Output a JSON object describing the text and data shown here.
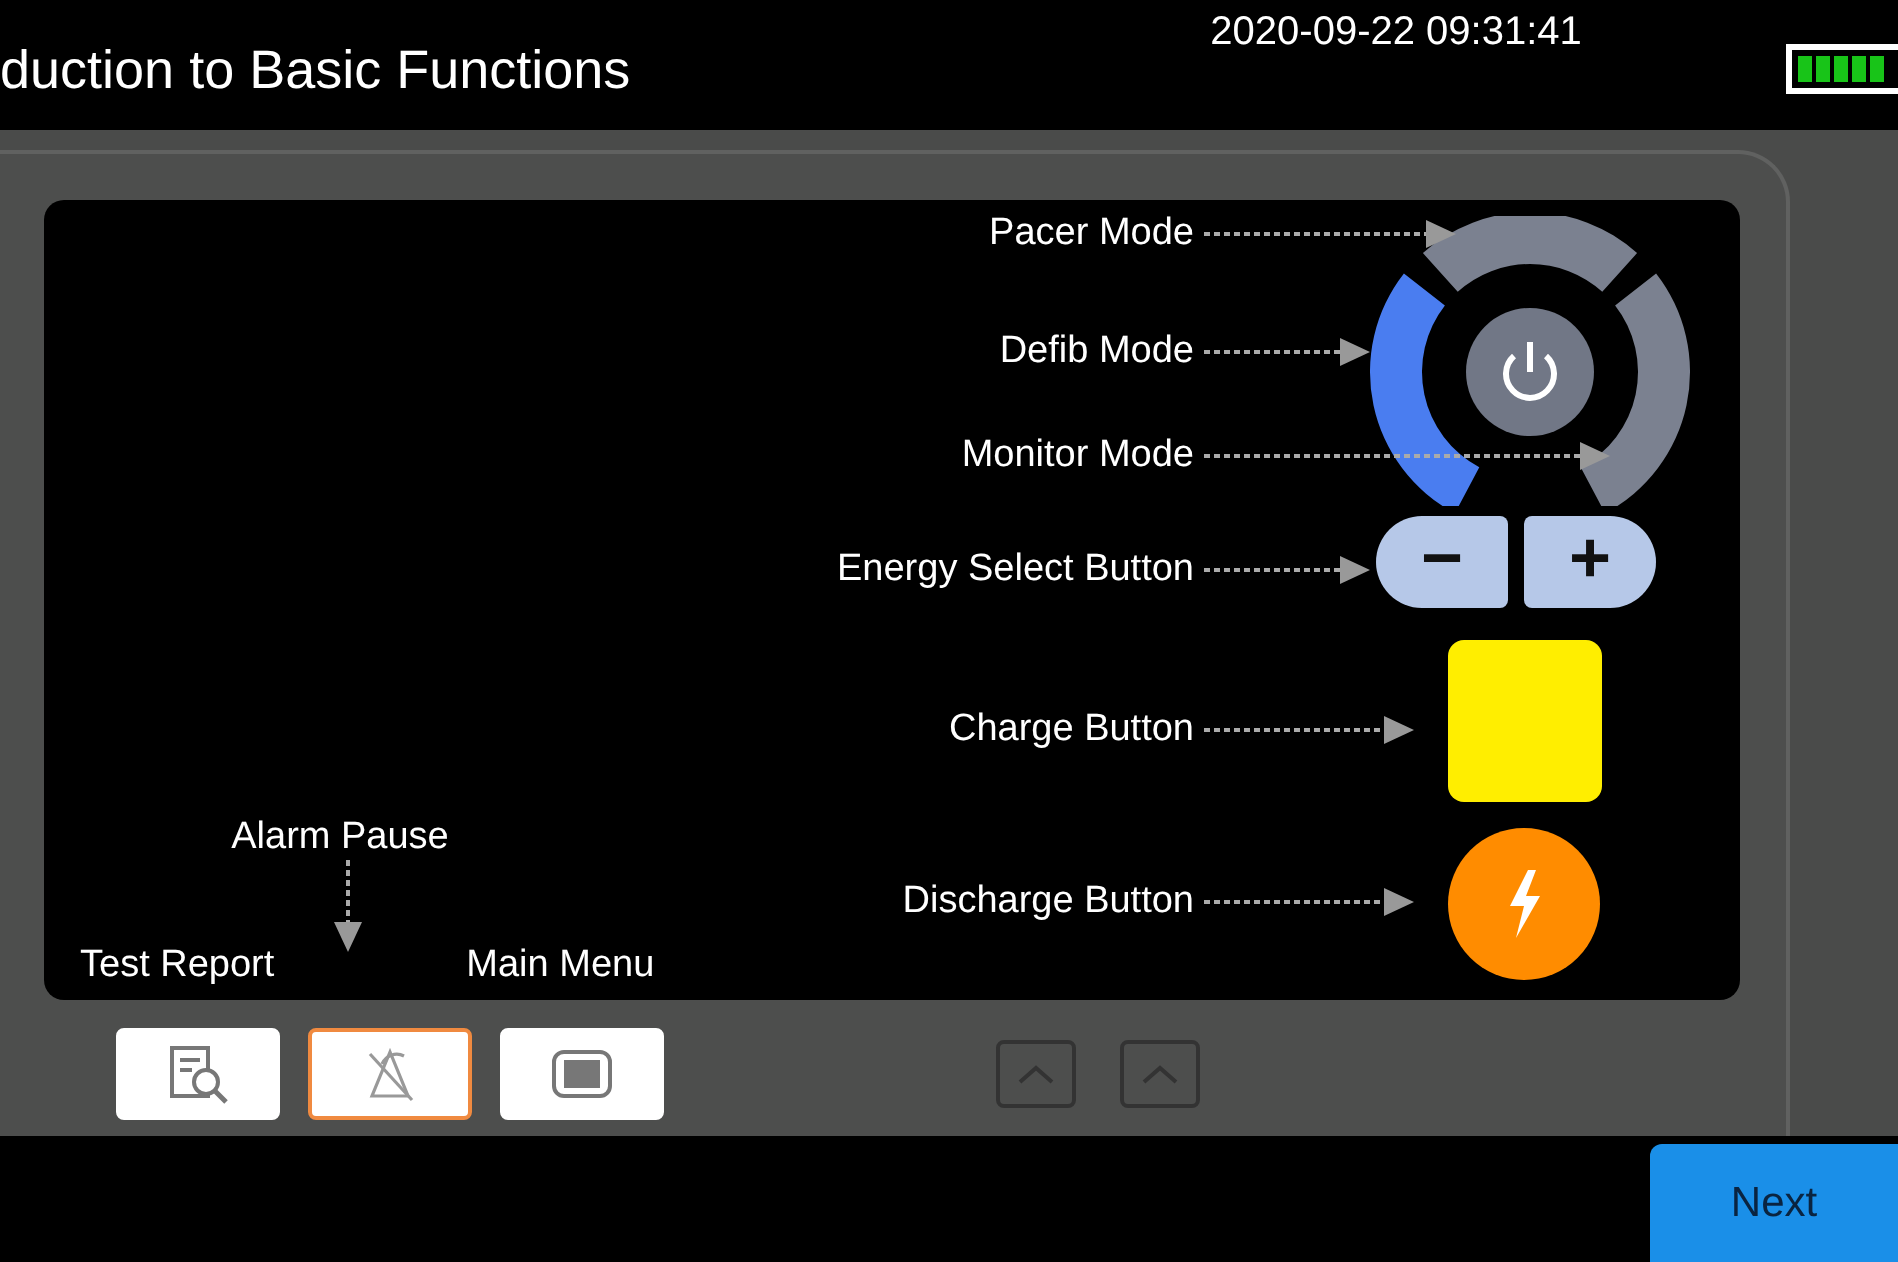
{
  "header": {
    "title": "duction to Basic Functions",
    "datetime": "2020-09-22 09:31:41"
  },
  "callouts": [
    {
      "label": "Pacer Mode"
    },
    {
      "label": "Defib Mode"
    },
    {
      "label": "Monitor Mode"
    },
    {
      "label": "Energy Select Button"
    },
    {
      "label": "Charge Button"
    },
    {
      "label": "Discharge Button"
    }
  ],
  "mode_dial": [
    {
      "selected": false
    },
    {
      "selected": true
    },
    {
      "selected": false
    }
  ],
  "energy_buttons": [
    "−",
    "+"
  ],
  "button_labels": {
    "alarm_pause": "Alarm Pause",
    "test_report": "Test Report",
    "main_menu": "Main Menu"
  },
  "soft_buttons": [
    {
      "kind": "report",
      "selected": false
    },
    {
      "kind": "alarm",
      "selected": true
    },
    {
      "kind": "menu",
      "selected": false
    }
  ],
  "next_button": "Next"
}
